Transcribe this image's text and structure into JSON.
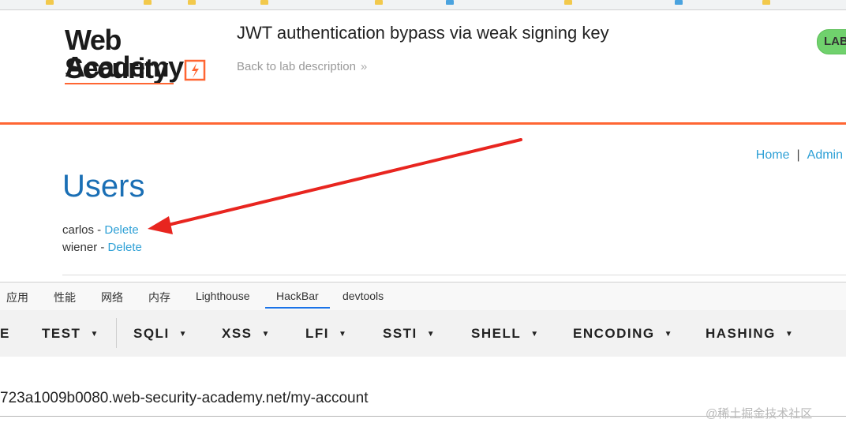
{
  "header": {
    "logo_line1": "Web Security",
    "logo_line2": "Academy",
    "lab_title": "JWT authentication bypass via weak signing key",
    "back_link": "Back to lab description",
    "badge": "LAB"
  },
  "nav": {
    "home": "Home",
    "separator": "|",
    "admin": "Admin"
  },
  "page": {
    "title": "Users",
    "users": [
      {
        "name": "carlos",
        "separator": " - ",
        "action": "Delete"
      },
      {
        "name": "wiener",
        "separator": " - ",
        "action": "Delete"
      }
    ]
  },
  "devtools": {
    "tabs": [
      "应用",
      "性能",
      "网络",
      "内存",
      "Lighthouse",
      "HackBar",
      "devtools"
    ],
    "active_tab": "HackBar"
  },
  "hackbar": {
    "menus": [
      "E",
      "TEST",
      "SQLI",
      "XSS",
      "LFI",
      "SSTI",
      "SHELL",
      "ENCODING",
      "HASHING"
    ]
  },
  "url": {
    "value": "723a1009b0080.web-security-academy.net/my-account"
  },
  "watermark": "@稀土掘金技术社区",
  "colors": {
    "accent_orange": "#ff6633",
    "link_blue": "#2ea0d6",
    "title_blue": "#1a6fb5",
    "badge_green": "#70d16d",
    "arrow_red": "#e8251f"
  }
}
